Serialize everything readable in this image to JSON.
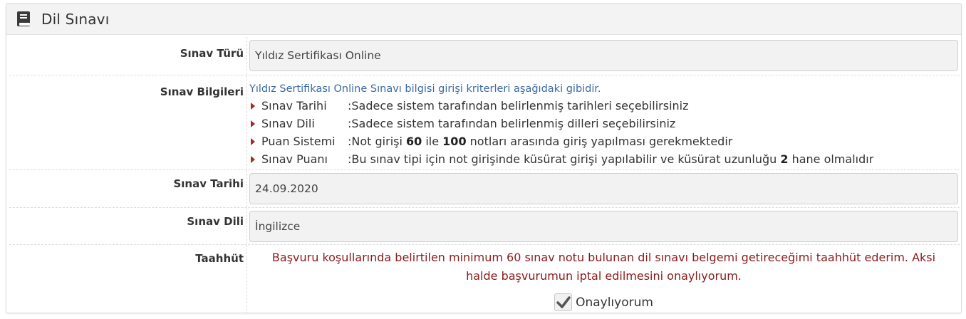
{
  "panel": {
    "title": "Dil Sınavı",
    "icon": "book-icon"
  },
  "fields": {
    "exam_type": {
      "label": "Sınav Türü",
      "value": "Yıldız Sertifikası Online"
    },
    "exam_info": {
      "label": "Sınav Bilgileri",
      "intro": "Yıldız Sertifikası Online Sınavı bilgisi girişi kriterleri aşağıdaki gibidir.",
      "criteria": [
        {
          "name": "Sınav Tarihi",
          "desc": ":Sadece sistem tarafından belirlenmiş tarihleri seçebilirsiniz"
        },
        {
          "name": "Sınav Dili",
          "desc": ":Sadece sistem tarafından belirlenmiş dilleri seçebilirsiniz"
        },
        {
          "name": "Puan Sistemi",
          "desc_pre": ":Not girişi ",
          "b1": "60",
          "desc_mid": " ile ",
          "b2": "100",
          "desc_post": " notları arasında giriş yapılması gerekmektedir"
        },
        {
          "name": "Sınav Puanı",
          "desc_pre": ":Bu sınav tipi için not girişinde küsürat girişi yapılabilir ve küsürat uzunluğu ",
          "b1": "2",
          "desc_post": " hane olmalıdır"
        }
      ]
    },
    "exam_date": {
      "label": "Sınav Tarihi",
      "value": "24.09.2020"
    },
    "exam_language": {
      "label": "Sınav Dili",
      "value": "İngilizce"
    },
    "commitment": {
      "label": "Taahhüt",
      "text_line1": "Başvuru koşullarında belirtilen minimum 60 sınav notu bulunan dil sınavı belgemi getireceğimi taahhüt ederim. Aksi",
      "text_line2": "halde başvurumun iptal edilmesini onaylıyorum.",
      "checkbox_label": "Onaylıyorum",
      "checked": true
    }
  },
  "colors": {
    "link_blue": "#3a6aa6",
    "warning_red": "#8b1a1a",
    "caret_red": "#a42a2a"
  }
}
